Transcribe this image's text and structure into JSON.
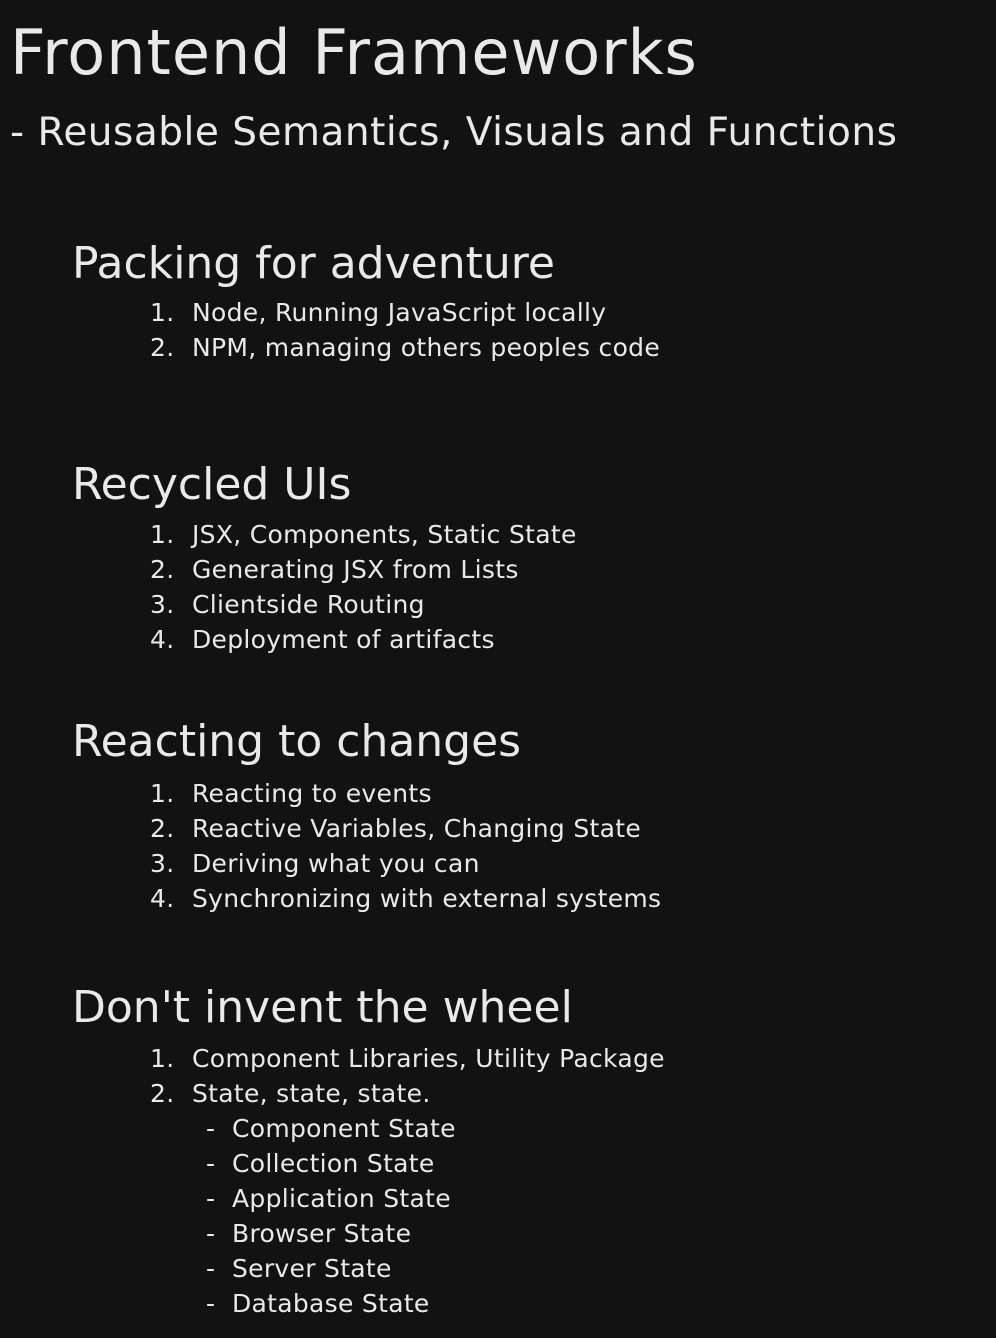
{
  "title": "Frontend Frameworks",
  "subtitle": "- Reusable Semantics, Visuals and Functions",
  "sections": [
    {
      "title": "Packing for adventure",
      "items": [
        {
          "num": "1.",
          "text": "Node, Running JavaScript locally"
        },
        {
          "num": "2.",
          "text": "NPM, managing others peoples code"
        }
      ]
    },
    {
      "title": "Recycled UIs",
      "items": [
        {
          "num": "1.",
          "text": "JSX, Components, Static State"
        },
        {
          "num": "2.",
          "text": "Generating JSX from Lists"
        },
        {
          "num": "3.",
          "text": "Clientside Routing"
        },
        {
          "num": "4.",
          "text": "Deployment of artifacts"
        }
      ]
    },
    {
      "title": "Reacting to changes",
      "items": [
        {
          "num": "1.",
          "text": "Reacting to events"
        },
        {
          "num": "2.",
          "text": "Reactive Variables, Changing State"
        },
        {
          "num": "3.",
          "text": "Deriving what you can"
        },
        {
          "num": "4.",
          "text": "Synchronizing with external systems"
        }
      ]
    },
    {
      "title": "Don't invent the wheel",
      "items": [
        {
          "num": "1.",
          "text": "Component Libraries, Utility Package"
        },
        {
          "num": "2.",
          "text": "State, state, state."
        }
      ],
      "subitems": [
        {
          "dash": "-",
          "text": "Component State"
        },
        {
          "dash": "-",
          "text": "Collection State"
        },
        {
          "dash": "-",
          "text": "Application State"
        },
        {
          "dash": "-",
          "text": "Browser State"
        },
        {
          "dash": "-",
          "text": "Server State"
        },
        {
          "dash": "-",
          "text": "Database State"
        }
      ]
    }
  ]
}
